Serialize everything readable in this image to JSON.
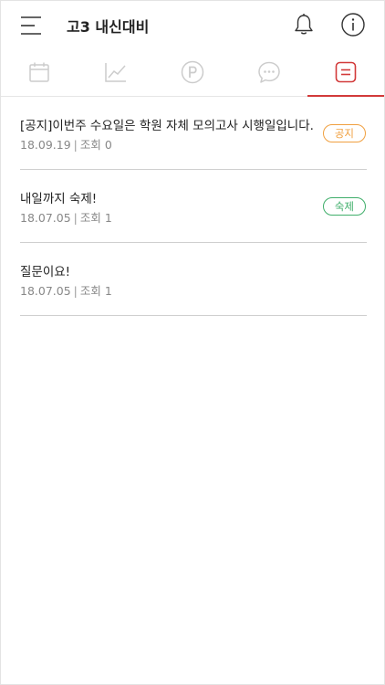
{
  "header": {
    "title": "고3 내신대비"
  },
  "tabs": [
    {
      "name": "calendar",
      "icon": "calendar-icon",
      "active": false
    },
    {
      "name": "chart",
      "icon": "line-chart-icon",
      "active": false
    },
    {
      "name": "point",
      "icon": "point-p-icon",
      "active": false
    },
    {
      "name": "chat",
      "icon": "chat-bubble-icon",
      "active": false
    },
    {
      "name": "board",
      "icon": "board-list-icon",
      "active": true
    }
  ],
  "colors": {
    "accent": "#d23a3a",
    "notice": "#f0a040",
    "homework": "#3fae6a",
    "icon_inactive": "#cccccc"
  },
  "posts": [
    {
      "title": "[공지]이번주 수요일은 학원 자체 모의고사 시행일입니다.",
      "date": "18.09.19",
      "views_label": "조회 0",
      "badge": "공지",
      "badge_type": "notice"
    },
    {
      "title": "내일까지 숙제!",
      "date": "18.07.05",
      "views_label": "조회 1",
      "badge": "숙제",
      "badge_type": "homework"
    },
    {
      "title": "질문이요!",
      "date": "18.07.05",
      "views_label": "조회 1",
      "badge": "",
      "badge_type": ""
    }
  ],
  "meta_separator": "|"
}
